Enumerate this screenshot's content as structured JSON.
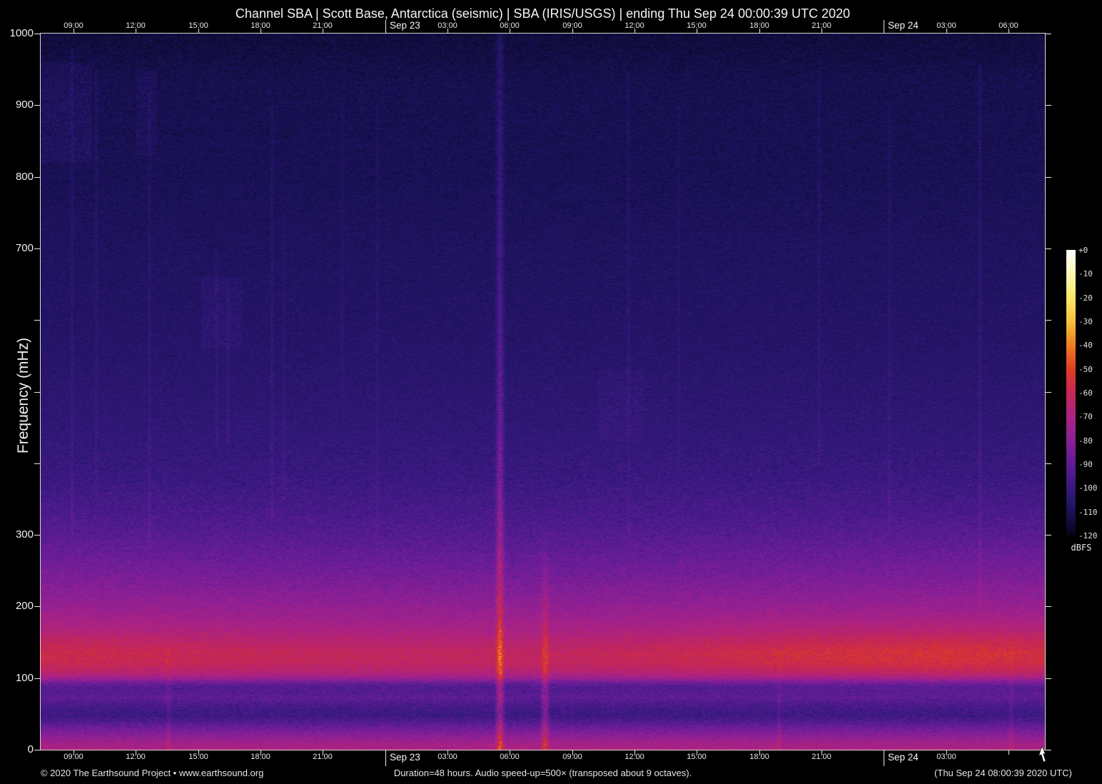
{
  "title": "Channel SBA | Scott Base, Antarctica (seismic) | SBA (IRIS/USGS) | ending Thu Sep 24 00:00:39 UTC 2020",
  "footer": {
    "left": "© 2020 The Earthsound Project • www.earthsound.org",
    "center": "Duration=48 hours. Audio speed-up=500× (transposed about 9 octaves).",
    "right": "(Thu Sep 24 08:00:39 2020 UTC)"
  },
  "chart_data": {
    "type": "heatmap",
    "subtype": "seismic-audio-spectrogram",
    "station": "SBA",
    "location": "Scott Base, Antarctica",
    "duration_hours": 48,
    "ylabel": "Frequency (mHz)",
    "ylim_mhz": [
      0,
      1000
    ],
    "x_ticks": [
      {
        "label": "09:00",
        "xf": 0.0327,
        "date": false,
        "bottom": true
      },
      {
        "label": "12:00",
        "xf": 0.0948,
        "date": false,
        "bottom": true
      },
      {
        "label": "15:00",
        "xf": 0.1569,
        "date": false,
        "bottom": true
      },
      {
        "label": "18:00",
        "xf": 0.2189,
        "date": false,
        "bottom": true
      },
      {
        "label": "21:00",
        "xf": 0.281,
        "date": false,
        "bottom": true
      },
      {
        "label": "Sep 23",
        "xf": 0.3431,
        "date": true,
        "bottom": true
      },
      {
        "label": "03:00",
        "xf": 0.4052,
        "date": false,
        "bottom": true
      },
      {
        "label": "06:00",
        "xf": 0.4672,
        "date": false,
        "bottom": true
      },
      {
        "label": "09:00",
        "xf": 0.5293,
        "date": false,
        "bottom": true
      },
      {
        "label": "12:00",
        "xf": 0.5914,
        "date": false,
        "bottom": true
      },
      {
        "label": "15:00",
        "xf": 0.6535,
        "date": false,
        "bottom": true
      },
      {
        "label": "18:00",
        "xf": 0.7156,
        "date": false,
        "bottom": true
      },
      {
        "label": "21:00",
        "xf": 0.7776,
        "date": false,
        "bottom": true
      },
      {
        "label": "Sep 24",
        "xf": 0.8397,
        "date": true,
        "bottom": true
      },
      {
        "label": "03:00",
        "xf": 0.9018,
        "date": false,
        "bottom": true
      },
      {
        "label": "06:00",
        "xf": 0.9639,
        "date": false,
        "bottom": false
      }
    ],
    "y_ticks": [
      {
        "label": "1000",
        "v": 1000
      },
      {
        "label": "900",
        "v": 900
      },
      {
        "label": "800",
        "v": 800
      },
      {
        "label": "700",
        "v": 700
      },
      {
        "label": "",
        "v": 600
      },
      {
        "label": "",
        "v": 500
      },
      {
        "label": "",
        "v": 400
      },
      {
        "label": "300",
        "v": 300
      },
      {
        "label": "200",
        "v": 200
      },
      {
        "label": "100",
        "v": 100
      },
      {
        "label": "0",
        "v": 0
      }
    ],
    "colorbar": {
      "title": "dBFS",
      "tick_labels": [
        "+0",
        "-10",
        "-20",
        "-30",
        "-40",
        "-50",
        "-60",
        "-70",
        "-80",
        "-90",
        "-100",
        "-110",
        "-120"
      ],
      "range_db": [
        0,
        -120
      ]
    },
    "colormap_stops": [
      {
        "db": 0,
        "color": "#ffffff"
      },
      {
        "db": -10,
        "color": "#fcf6b5"
      },
      {
        "db": -20,
        "color": "#f8e967"
      },
      {
        "db": -30,
        "color": "#f5c13d"
      },
      {
        "db": -40,
        "color": "#ef7e1f"
      },
      {
        "db": -50,
        "color": "#e03c24"
      },
      {
        "db": -60,
        "color": "#c52756"
      },
      {
        "db": -70,
        "color": "#ad2383"
      },
      {
        "db": -80,
        "color": "#8a2097"
      },
      {
        "db": -90,
        "color": "#5e1d96"
      },
      {
        "db": -100,
        "color": "#35197d"
      },
      {
        "db": -110,
        "color": "#191257"
      },
      {
        "db": -120,
        "color": "#050514"
      }
    ],
    "freq_profile_db": [
      [
        1000,
        -114
      ],
      [
        930,
        -111
      ],
      [
        800,
        -110
      ],
      [
        700,
        -108
      ],
      [
        550,
        -105
      ],
      [
        450,
        -102
      ],
      [
        380,
        -99
      ],
      [
        330,
        -95
      ],
      [
        300,
        -92
      ],
      [
        270,
        -88
      ],
      [
        240,
        -84
      ],
      [
        210,
        -79
      ],
      [
        185,
        -74
      ],
      [
        165,
        -69
      ],
      [
        150,
        -64
      ],
      [
        135,
        -60
      ],
      [
        120,
        -61
      ],
      [
        108,
        -66
      ],
      [
        100,
        -74
      ],
      [
        94,
        -85
      ],
      [
        88,
        -92
      ],
      [
        80,
        -92
      ],
      [
        72,
        -90
      ],
      [
        64,
        -94
      ],
      [
        55,
        -97
      ],
      [
        47,
        -98
      ],
      [
        40,
        -94
      ],
      [
        33,
        -89
      ],
      [
        26,
        -84
      ],
      [
        18,
        -79
      ],
      [
        10,
        -74
      ],
      [
        4,
        -71
      ],
      [
        0,
        -70
      ]
    ],
    "microseism_band_boost_by_xfrac": [
      [
        0,
        2
      ],
      [
        0.1,
        1
      ],
      [
        0.25,
        -1
      ],
      [
        0.4,
        -2
      ],
      [
        0.5,
        -2
      ],
      [
        0.6,
        0
      ],
      [
        0.68,
        2
      ],
      [
        0.75,
        4
      ],
      [
        0.82,
        5
      ],
      [
        0.9,
        6
      ],
      [
        0.96,
        5
      ],
      [
        1,
        4
      ]
    ],
    "broad_boost_by_xfrac": [
      [
        0,
        1.5
      ],
      [
        0.2,
        0
      ],
      [
        0.5,
        -1
      ],
      [
        0.75,
        0.5
      ],
      [
        1,
        1.5
      ]
    ],
    "streaks": [
      {
        "xf": 0.457,
        "w": 5,
        "f0": 0,
        "f1": 1000,
        "db0": 26,
        "db1": 8
      },
      {
        "xf": 0.502,
        "w": 5,
        "f0": 0,
        "f1": 330,
        "db0": 22,
        "db1": 0
      },
      {
        "xf": 0.127,
        "w": 3,
        "f0": 0,
        "f1": 170,
        "db0": 9,
        "db1": 0
      },
      {
        "xf": 0.735,
        "w": 3,
        "f0": 0,
        "f1": 150,
        "db0": 8,
        "db1": 0
      },
      {
        "xf": 0.966,
        "w": 3,
        "f0": 0,
        "f1": 160,
        "db0": 9,
        "db1": 0
      },
      {
        "xf": 0.031,
        "w": 2,
        "f0": 300,
        "f1": 980,
        "db0": 5,
        "db1": 5
      },
      {
        "xf": 0.055,
        "w": 2,
        "f0": 350,
        "f1": 950,
        "db0": 4,
        "db1": 5
      },
      {
        "xf": 0.108,
        "w": 2,
        "f0": 280,
        "f1": 920,
        "db0": 5,
        "db1": 4
      },
      {
        "xf": 0.175,
        "w": 2,
        "f0": 420,
        "f1": 700,
        "db0": 5,
        "db1": 3
      },
      {
        "xf": 0.186,
        "w": 2,
        "f0": 430,
        "f1": 650,
        "db0": 6,
        "db1": 3
      },
      {
        "xf": 0.23,
        "w": 2,
        "f0": 320,
        "f1": 900,
        "db0": 5,
        "db1": 4
      },
      {
        "xf": 0.242,
        "w": 2,
        "f0": 350,
        "f1": 750,
        "db0": 4,
        "db1": 3
      },
      {
        "xf": 0.3,
        "w": 2,
        "f0": 500,
        "f1": 900,
        "db0": 4,
        "db1": 3
      },
      {
        "xf": 0.335,
        "w": 2,
        "f0": 300,
        "f1": 900,
        "db0": 3,
        "db1": 4
      },
      {
        "xf": 0.585,
        "w": 2,
        "f0": 300,
        "f1": 950,
        "db0": 4,
        "db1": 4
      },
      {
        "xf": 0.635,
        "w": 2,
        "f0": 400,
        "f1": 900,
        "db0": 3,
        "db1": 3
      },
      {
        "xf": 0.775,
        "w": 2,
        "f0": 400,
        "f1": 950,
        "db0": 4,
        "db1": 4
      },
      {
        "xf": 0.845,
        "w": 2,
        "f0": 300,
        "f1": 900,
        "db0": 4,
        "db1": 4
      },
      {
        "xf": 0.935,
        "w": 2,
        "f0": 200,
        "f1": 960,
        "db0": 5,
        "db1": 6
      }
    ],
    "patches": [
      {
        "x0": 0.0,
        "x1": 0.05,
        "f0": 820,
        "f1": 960,
        "db": 6
      },
      {
        "x0": 0.095,
        "x1": 0.115,
        "f0": 830,
        "f1": 950,
        "db": 5
      },
      {
        "x0": 0.16,
        "x1": 0.2,
        "f0": 560,
        "f1": 660,
        "db": 5
      },
      {
        "x0": 0.555,
        "x1": 0.6,
        "f0": 430,
        "f1": 530,
        "db": 4
      }
    ],
    "noise": {
      "amp_high_freq_db": 5.5,
      "amp_low_freq_db": 7.5,
      "spike_prob": 0.05
    }
  }
}
